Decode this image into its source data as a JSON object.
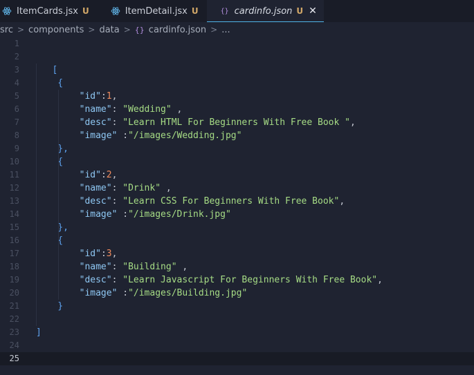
{
  "tabs": [
    {
      "label": "ItemCards.jsx",
      "status": "U",
      "icon": "react-icon",
      "active": false
    },
    {
      "label": "ItemDetail.jsx",
      "status": "U",
      "icon": "react-icon",
      "active": false
    },
    {
      "label": "cardinfo.json",
      "status": "U",
      "icon": "json-braces-icon",
      "active": true,
      "close": "✕"
    }
  ],
  "breadcrumb": {
    "items": [
      "src",
      "components",
      "data",
      "cardinfo.json",
      "..."
    ],
    "separator": ">",
    "file_icon": "{}"
  },
  "editor": {
    "current_line": 25,
    "lines": [
      {
        "n": "1",
        "indent": 0,
        "tokens": []
      },
      {
        "n": "2",
        "indent": 0,
        "tokens": []
      },
      {
        "n": "3",
        "indent": 0,
        "tokens": [
          {
            "t": "   [",
            "c": "brk"
          }
        ]
      },
      {
        "n": "4",
        "indent": 0,
        "tokens": [
          {
            "t": "    {",
            "c": "brk"
          }
        ]
      },
      {
        "n": "5",
        "indent": 0,
        "tokens": [
          {
            "t": "        ",
            "c": "punc"
          },
          {
            "t": "\"id\"",
            "c": "key"
          },
          {
            "t": ":",
            "c": "punc"
          },
          {
            "t": "1",
            "c": "num"
          },
          {
            "t": ",",
            "c": "punc"
          }
        ]
      },
      {
        "n": "6",
        "indent": 0,
        "tokens": [
          {
            "t": "        ",
            "c": "punc"
          },
          {
            "t": "\"name\"",
            "c": "key"
          },
          {
            "t": ": ",
            "c": "punc"
          },
          {
            "t": "\"Wedding\"",
            "c": "str"
          },
          {
            "t": " ,",
            "c": "punc"
          }
        ]
      },
      {
        "n": "7",
        "indent": 0,
        "tokens": [
          {
            "t": "        ",
            "c": "punc"
          },
          {
            "t": "\"desc\"",
            "c": "key"
          },
          {
            "t": ": ",
            "c": "punc"
          },
          {
            "t": "\"Learn HTML For Beginners With Free Book \"",
            "c": "str"
          },
          {
            "t": ",",
            "c": "punc"
          }
        ]
      },
      {
        "n": "8",
        "indent": 0,
        "tokens": [
          {
            "t": "        ",
            "c": "punc"
          },
          {
            "t": "\"image\"",
            "c": "key"
          },
          {
            "t": " :",
            "c": "punc"
          },
          {
            "t": "\"/images/Wedding.jpg\"",
            "c": "str"
          }
        ]
      },
      {
        "n": "9",
        "indent": 0,
        "tokens": [
          {
            "t": "    },",
            "c": "brk"
          }
        ]
      },
      {
        "n": "10",
        "indent": 0,
        "tokens": [
          {
            "t": "    {",
            "c": "brk"
          }
        ]
      },
      {
        "n": "11",
        "indent": 0,
        "tokens": [
          {
            "t": "        ",
            "c": "punc"
          },
          {
            "t": "\"id\"",
            "c": "key"
          },
          {
            "t": ":",
            "c": "punc"
          },
          {
            "t": "2",
            "c": "num"
          },
          {
            "t": ",",
            "c": "punc"
          }
        ]
      },
      {
        "n": "12",
        "indent": 0,
        "tokens": [
          {
            "t": "        ",
            "c": "punc"
          },
          {
            "t": "\"name\"",
            "c": "key"
          },
          {
            "t": ": ",
            "c": "punc"
          },
          {
            "t": "\"Drink\"",
            "c": "str"
          },
          {
            "t": " ,",
            "c": "punc"
          }
        ]
      },
      {
        "n": "13",
        "indent": 0,
        "tokens": [
          {
            "t": "        ",
            "c": "punc"
          },
          {
            "t": "\"desc\"",
            "c": "key"
          },
          {
            "t": ": ",
            "c": "punc"
          },
          {
            "t": "\"Learn CSS For Beginners With Free Book\"",
            "c": "str"
          },
          {
            "t": ",",
            "c": "punc"
          }
        ]
      },
      {
        "n": "14",
        "indent": 0,
        "tokens": [
          {
            "t": "        ",
            "c": "punc"
          },
          {
            "t": "\"image\"",
            "c": "key"
          },
          {
            "t": " :",
            "c": "punc"
          },
          {
            "t": "\"/images/Drink.jpg\"",
            "c": "str"
          }
        ]
      },
      {
        "n": "15",
        "indent": 0,
        "tokens": [
          {
            "t": "    },",
            "c": "brk"
          }
        ]
      },
      {
        "n": "16",
        "indent": 0,
        "tokens": [
          {
            "t": "    {",
            "c": "brk"
          }
        ]
      },
      {
        "n": "17",
        "indent": 0,
        "tokens": [
          {
            "t": "        ",
            "c": "punc"
          },
          {
            "t": "\"id\"",
            "c": "key"
          },
          {
            "t": ":",
            "c": "punc"
          },
          {
            "t": "3",
            "c": "num"
          },
          {
            "t": ",",
            "c": "punc"
          }
        ]
      },
      {
        "n": "18",
        "indent": 0,
        "tokens": [
          {
            "t": "        ",
            "c": "punc"
          },
          {
            "t": "\"name\"",
            "c": "key"
          },
          {
            "t": ": ",
            "c": "punc"
          },
          {
            "t": "\"Building\"",
            "c": "str"
          },
          {
            "t": " ,",
            "c": "punc"
          }
        ]
      },
      {
        "n": "19",
        "indent": 0,
        "tokens": [
          {
            "t": "        ",
            "c": "punc"
          },
          {
            "t": "\"desc\"",
            "c": "key"
          },
          {
            "t": ": ",
            "c": "punc"
          },
          {
            "t": "\"Learn Javascript For Beginners With Free Book\"",
            "c": "str"
          },
          {
            "t": ",",
            "c": "punc"
          }
        ]
      },
      {
        "n": "20",
        "indent": 0,
        "tokens": [
          {
            "t": "        ",
            "c": "punc"
          },
          {
            "t": "\"image\"",
            "c": "key"
          },
          {
            "t": " :",
            "c": "punc"
          },
          {
            "t": "\"/images/Building.jpg\"",
            "c": "str"
          }
        ]
      },
      {
        "n": "21",
        "indent": 0,
        "tokens": [
          {
            "t": "    }",
            "c": "brk"
          }
        ]
      },
      {
        "n": "22",
        "indent": 0,
        "tokens": []
      },
      {
        "n": "23",
        "indent": 0,
        "tokens": [
          {
            "t": "]",
            "c": "brk"
          }
        ]
      },
      {
        "n": "24",
        "indent": 0,
        "tokens": []
      },
      {
        "n": "25",
        "indent": 0,
        "tokens": []
      }
    ]
  },
  "colors": {
    "background": "#1f2331",
    "key": "#8fc8f4",
    "string": "#a6dc85",
    "number": "#f28d5f",
    "bracket": "#5ea3f0",
    "tab_status": "#d1a768",
    "active_tab_underline": "#4fb4e8"
  }
}
